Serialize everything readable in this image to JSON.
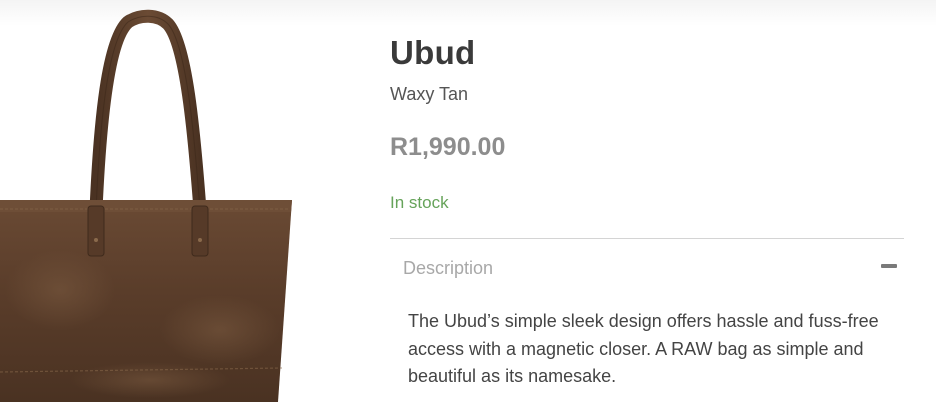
{
  "product": {
    "image_alt": "Ubud leather tote bag in Waxy Tan",
    "title": "Ubud",
    "variant": "Waxy Tan",
    "price": "R1,990.00",
    "stock_status": "In stock"
  },
  "description": {
    "label": "Description",
    "expanded": true,
    "text": "The Ubud’s simple sleek design offers hassle and fuss-free access with a magnetic closer. A RAW bag as simple and beautiful as its namesake."
  },
  "colors": {
    "stock": "#66a35a",
    "price": "#8d8d8d",
    "leather": "#5b3d2a"
  }
}
